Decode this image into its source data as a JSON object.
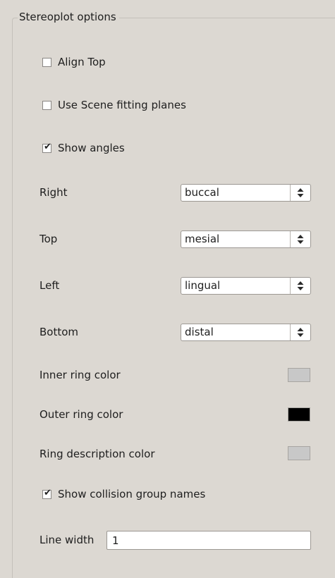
{
  "panel": {
    "title": "Stereoplot options"
  },
  "checkboxes": {
    "align_top": {
      "label": "Align Top",
      "checked": false
    },
    "use_scene_fitting_planes": {
      "label": "Use Scene fitting planes",
      "checked": false
    },
    "show_angles": {
      "label": "Show angles",
      "checked": true
    },
    "show_collision_group_names": {
      "label": "Show collision group names",
      "checked": true
    }
  },
  "directions": {
    "right": {
      "label": "Right",
      "value": "buccal"
    },
    "top": {
      "label": "Top",
      "value": "mesial"
    },
    "left": {
      "label": "Left",
      "value": "lingual"
    },
    "bottom": {
      "label": "Bottom",
      "value": "distal"
    }
  },
  "colors": {
    "inner_ring": {
      "label": "Inner ring color",
      "color": "#c8c8c8"
    },
    "outer_ring": {
      "label": "Outer ring color",
      "color": "#000000"
    },
    "ring_description": {
      "label": "Ring description color",
      "color": "#c8c8c8"
    }
  },
  "line_width": {
    "label": "Line width",
    "value": "1"
  },
  "icons": {
    "checkmark": "✔",
    "combo_arrows": "up-down-arrows-icon"
  }
}
